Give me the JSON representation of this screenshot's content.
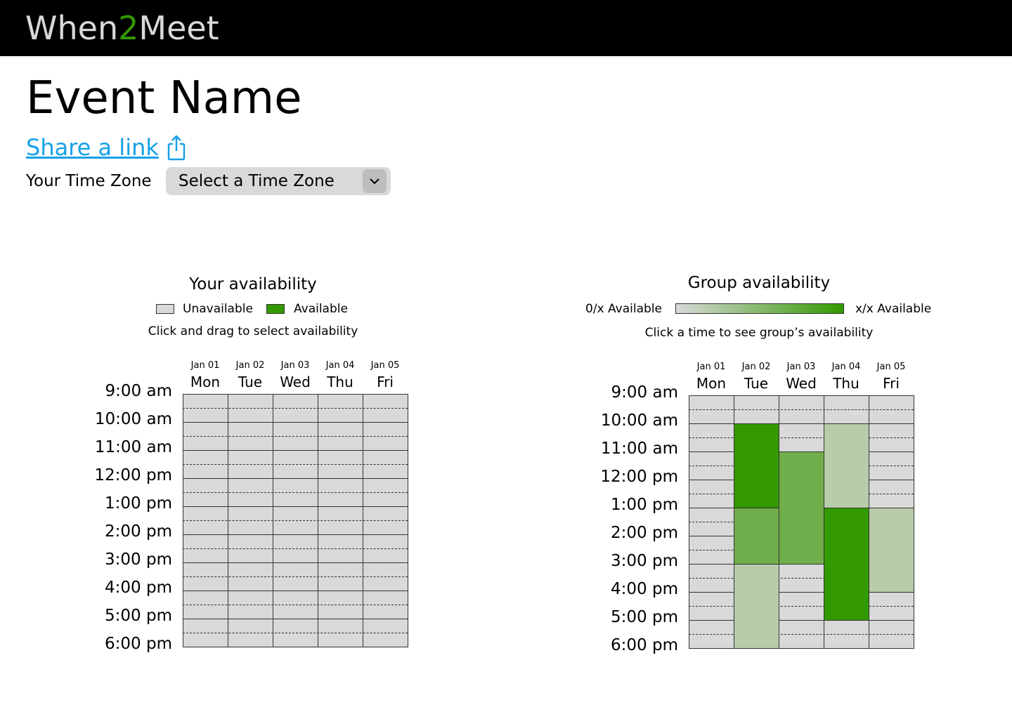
{
  "header": {
    "logo_part1": "When",
    "logo_part2": "2",
    "logo_part3": "Meet"
  },
  "event": {
    "title": "Event Name",
    "share_link_label": "Share a link",
    "share_icon": "share-icon"
  },
  "timezone": {
    "label": "Your Time Zone",
    "selected": "Select a Time Zone",
    "dropdown_icon": "chevron-down-icon"
  },
  "your_availability": {
    "title": "Your availability",
    "legend_unavailable": "Unavailable",
    "legend_available": "Available",
    "hint": "Click and drag to select availability"
  },
  "group_availability": {
    "title": "Group availability",
    "legend_min": "0/x Available",
    "legend_max": "x/x Available",
    "hint": "Click a time to see group’s availability"
  },
  "schedule": {
    "days": [
      {
        "date": "Jan 01",
        "day": "Mon"
      },
      {
        "date": "Jan 02",
        "day": "Tue"
      },
      {
        "date": "Jan 03",
        "day": "Wed"
      },
      {
        "date": "Jan 04",
        "day": "Thu"
      },
      {
        "date": "Jan 05",
        "day": "Fri"
      }
    ],
    "times": [
      "9:00 am",
      "10:00 am",
      "11:00 am",
      "12:00 pm",
      "1:00 pm",
      "2:00 pm",
      "3:00 pm",
      "4:00 pm",
      "5:00 pm",
      "6:00 pm"
    ],
    "slots_per_hour": 2
  },
  "group_blocks": [
    {
      "day": "Tue",
      "start": "10:00 am",
      "end": "1:00 pm",
      "level": 1.0
    },
    {
      "day": "Tue",
      "start": "1:00 pm",
      "end": "3:00 pm",
      "level": 0.66
    },
    {
      "day": "Tue",
      "start": "3:00 pm",
      "end": "6:00 pm",
      "level": 0.33
    },
    {
      "day": "Wed",
      "start": "11:00 am",
      "end": "3:00 pm",
      "level": 0.66
    },
    {
      "day": "Thu",
      "start": "10:00 am",
      "end": "1:00 pm",
      "level": 0.33
    },
    {
      "day": "Thu",
      "start": "1:00 pm",
      "end": "5:00 pm",
      "level": 1.0
    },
    {
      "day": "Fri",
      "start": "1:00 pm",
      "end": "4:00 pm",
      "level": 0.33
    }
  ],
  "colors": {
    "unavailable": "#d9d9d9",
    "available": "#339900",
    "level_0_33": "#b8ccaa",
    "level_0_66": "#70ad4b",
    "level_1_0": "#339900",
    "link": "#18a0e6"
  }
}
